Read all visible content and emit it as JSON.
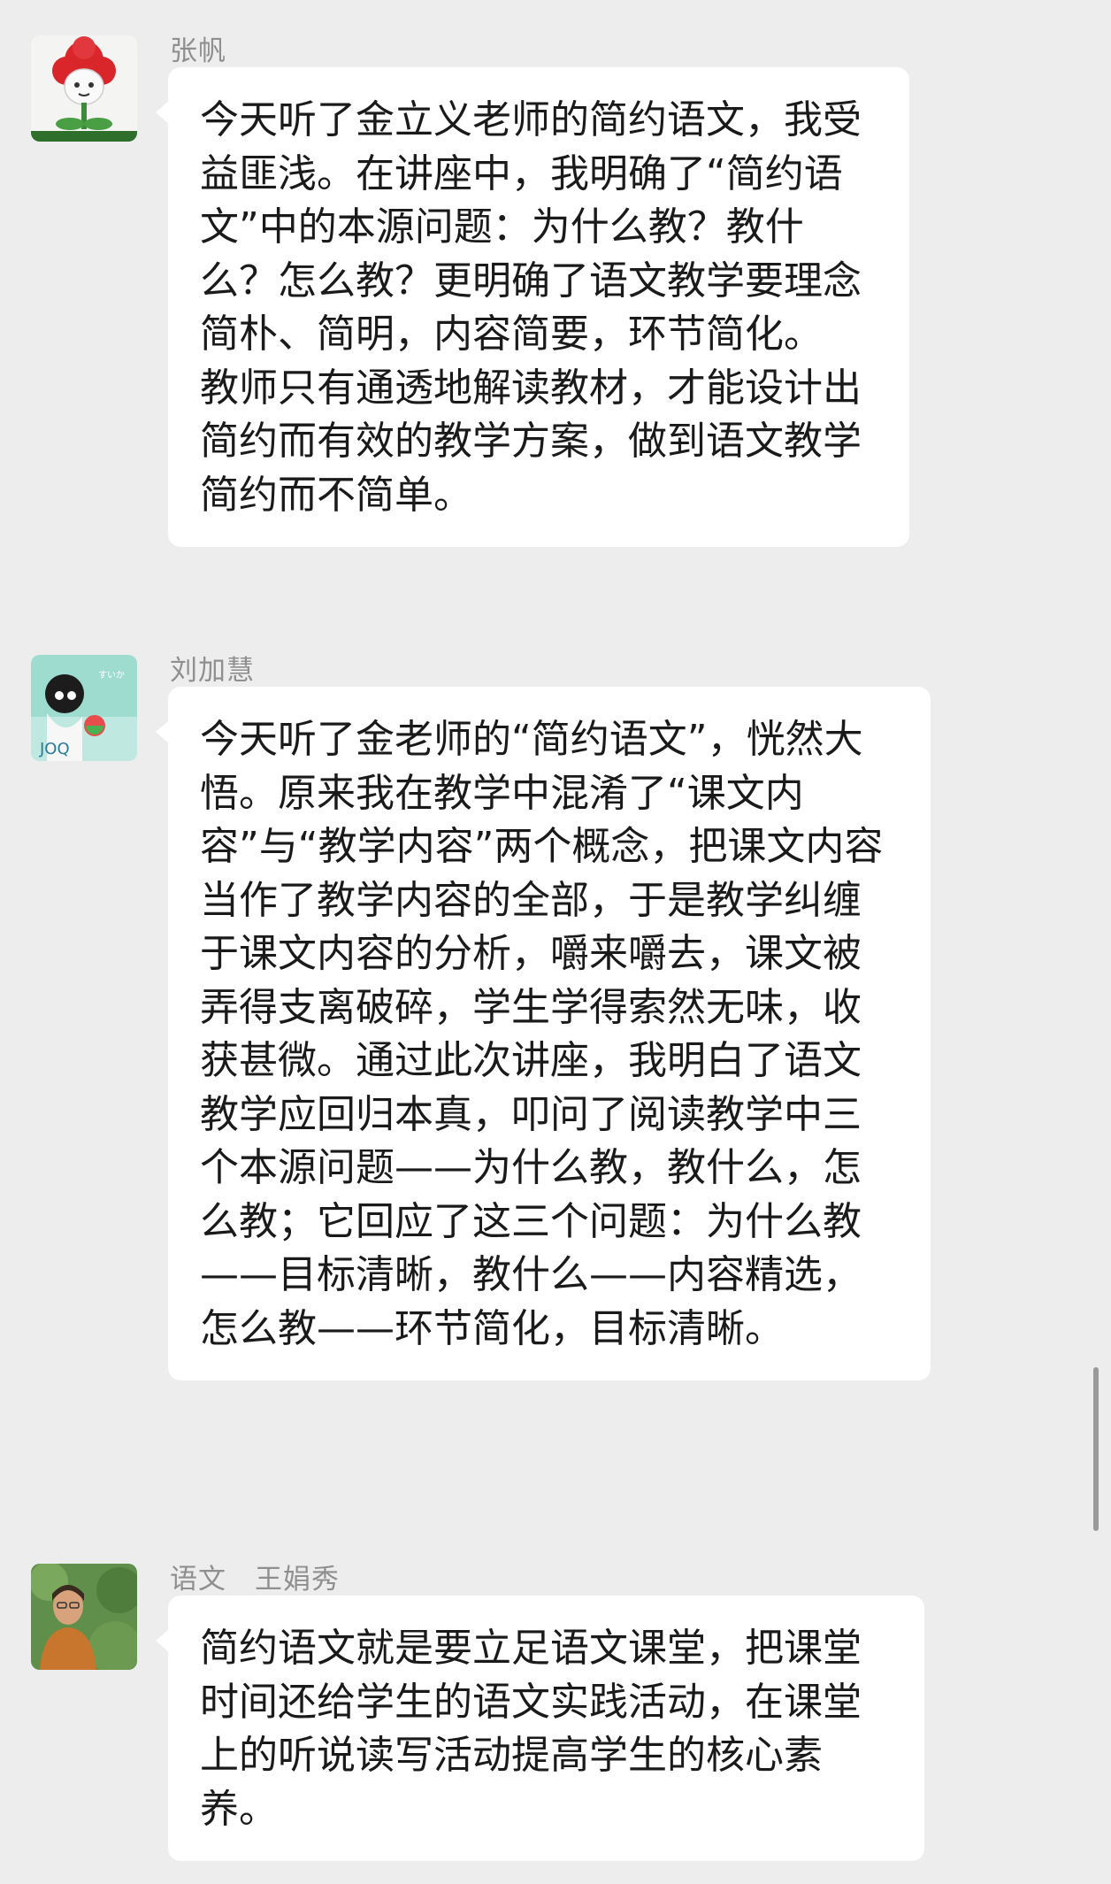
{
  "messages": [
    {
      "sender": "张帆",
      "text": "今天听了金立义老师的简约语文，我受益匪浅。在讲座中，我明确了“简约语文”中的本源问题：为什么教？教什么？怎么教？更明确了语文教学要理念简朴、简明，内容简要，环节简化。\n教师只有通透地解读教材，才能设计出简约而有效的教学方案，做到语文教学简约而不简单。",
      "avatar": "flower-avatar"
    },
    {
      "sender": "刘加慧",
      "text": "今天听了金老师的“简约语文”，恍然大悟。原来我在教学中混淆了“课文内容”与“教学内容”两个概念，把课文内容当作了教学内容的全部，于是教学纠缠于课文内容的分析，嚼来嚼去，课文被弄得支离破碎，学生学得索然无味，收获甚微。通过此次讲座，我明白了语文教学应回归本真，叩问了阅读教学中三个本源问题——为什么教，教什么，怎么教；它回应了这三个问题：为什么教——目标清晰，教什么——内容精选，怎么教——环节简化，目标清晰。",
      "avatar": "cartoon-avatar"
    },
    {
      "sender": "语文　王娟秀",
      "text": "简约语文就是要立足语文课堂，把课堂时间还给学生的语文实践活动，在课堂上的听说读写活动提高学生的核心素养。",
      "avatar": "photo-avatar"
    }
  ],
  "colors": {
    "background": "#ededed",
    "bubble": "#ffffff",
    "text": "#1a1a1a",
    "sender": "#8f8f8f"
  }
}
